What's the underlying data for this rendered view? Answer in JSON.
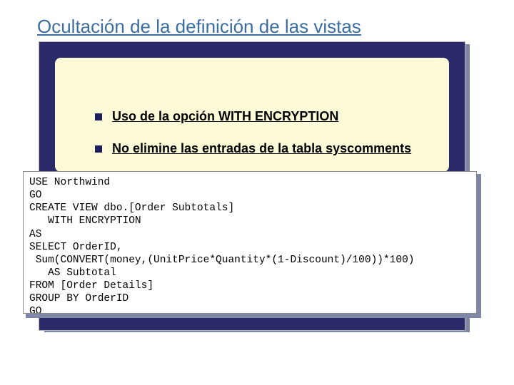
{
  "title": "Ocultación de la definición de las vistas",
  "bullets": [
    "Uso de la opción WITH ENCRYPTION",
    "No elimine las entradas de la tabla syscomments"
  ],
  "code": "USE Northwind\nGO\nCREATE VIEW dbo.[Order Subtotals]\n   WITH ENCRYPTION\nAS\nSELECT OrderID,\n Sum(CONVERT(money,(UnitPrice*Quantity*(1-Discount)/100))*100)\n   AS Subtotal\nFROM [Order Details]\nGROUP BY OrderID\nGO"
}
